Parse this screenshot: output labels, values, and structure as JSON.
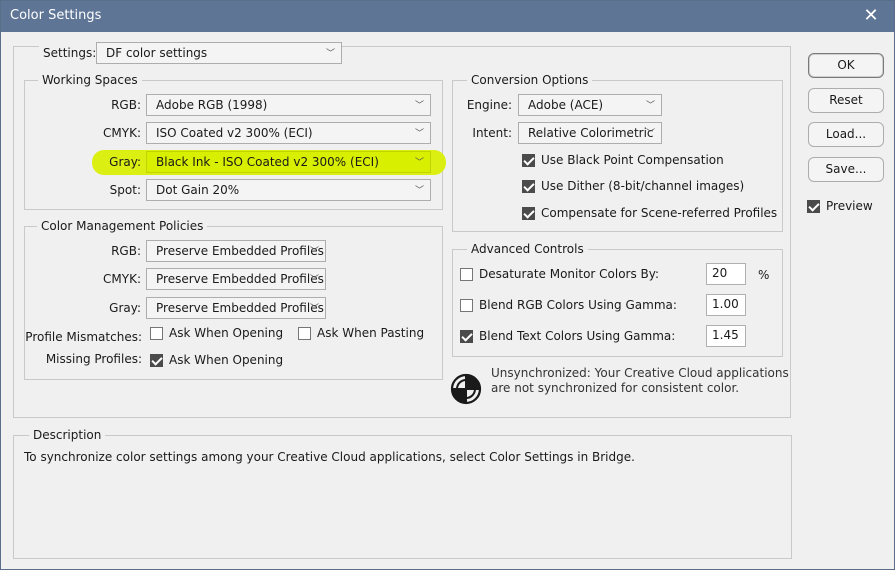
{
  "window": {
    "title": "Color Settings",
    "close_glyph": "✕"
  },
  "settings": {
    "label": "Settings:",
    "value": "DF color settings"
  },
  "working_spaces": {
    "title": "Working Spaces",
    "rgb": {
      "label": "RGB:",
      "value": "Adobe RGB (1998)"
    },
    "cmyk": {
      "label": "CMYK:",
      "value": "ISO Coated v2 300% (ECI)"
    },
    "gray": {
      "label": "Gray:",
      "value": "Black Ink - ISO Coated v2 300% (ECI)",
      "highlight_color": "#d9ef00"
    },
    "spot": {
      "label": "Spot:",
      "value": "Dot Gain 20%"
    }
  },
  "policies": {
    "title": "Color Management Policies",
    "rgb": {
      "label": "RGB:",
      "value": "Preserve Embedded Profiles"
    },
    "cmyk": {
      "label": "CMYK:",
      "value": "Preserve Embedded Profiles"
    },
    "gray": {
      "label": "Gray:",
      "value": "Preserve Embedded Profiles"
    },
    "mismatch_label": "Profile Mismatches:",
    "ask_opening": {
      "label": "Ask When Opening",
      "checked": false
    },
    "ask_pasting": {
      "label": "Ask When Pasting",
      "checked": false
    },
    "missing_label": "Missing Profiles:",
    "missing_ask_opening": {
      "label": "Ask When Opening",
      "checked": true
    }
  },
  "conversion": {
    "title": "Conversion Options",
    "engine": {
      "label": "Engine:",
      "value": "Adobe (ACE)"
    },
    "intent": {
      "label": "Intent:",
      "value": "Relative Colorimetric"
    },
    "bpc": {
      "label": "Use Black Point Compensation",
      "checked": true
    },
    "dither": {
      "label": "Use Dither (8-bit/channel images)",
      "checked": true
    },
    "scene": {
      "label": "Compensate for Scene-referred Profiles",
      "checked": true
    }
  },
  "advanced": {
    "title": "Advanced Controls",
    "desaturate": {
      "label": "Desaturate Monitor Colors By:",
      "value": "20",
      "unit": "%",
      "checked": false
    },
    "blend_rgb": {
      "label": "Blend RGB Colors Using Gamma:",
      "value": "1.00",
      "checked": false
    },
    "blend_text": {
      "label": "Blend Text Colors Using Gamma:",
      "value": "1.45",
      "checked": true
    }
  },
  "sync": {
    "line1": "Unsynchronized: Your Creative Cloud applications",
    "line2": "are not synchronized for consistent color."
  },
  "buttons": {
    "ok": "OK",
    "reset": "Reset",
    "load": "Load...",
    "save": "Save...",
    "preview": "Preview",
    "preview_checked": true
  },
  "description": {
    "title": "Description",
    "text": "To synchronize color settings among your Creative Cloud applications, select Color Settings in Bridge."
  }
}
